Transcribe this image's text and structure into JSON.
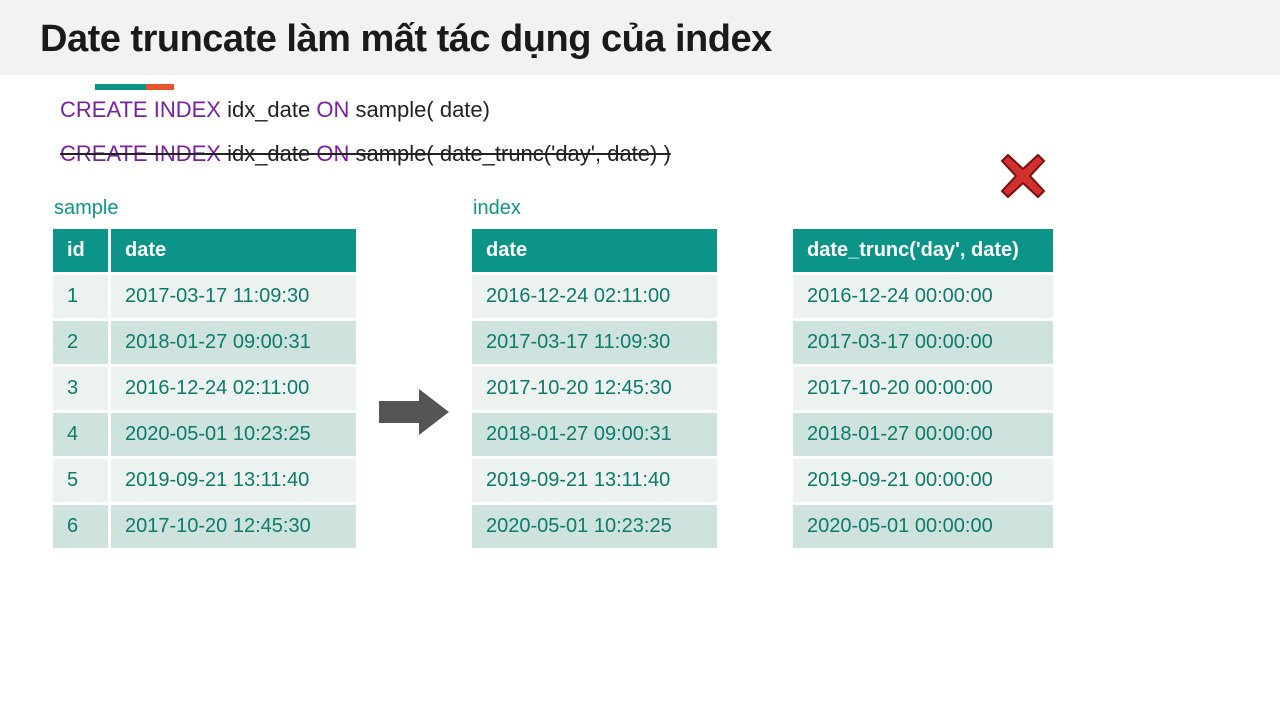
{
  "title": "Date truncate làm mất tác dụng của index",
  "sql1": {
    "create": "CREATE INDEX",
    "name": " idx_date ",
    "on": "ON",
    "rest": " sample( date)"
  },
  "sql2": {
    "create": "CREATE INDEX",
    "name": " idx_date ",
    "on": "ON",
    "rest": " sample( date_trunc('day', date) )"
  },
  "sampleLabel": "sample",
  "indexLabel": "index",
  "sample": {
    "headers": {
      "id": "id",
      "date": "date"
    },
    "rows": [
      {
        "id": "1",
        "date": "2017-03-17 11:09:30"
      },
      {
        "id": "2",
        "date": "2018-01-27 09:00:31"
      },
      {
        "id": "3",
        "date": "2016-12-24 02:11:00"
      },
      {
        "id": "4",
        "date": "2020-05-01 10:23:25"
      },
      {
        "id": "5",
        "date": "2019-09-21 13:11:40"
      },
      {
        "id": "6",
        "date": "2017-10-20 12:45:30"
      }
    ]
  },
  "index": {
    "header": "date",
    "rows": [
      "2016-12-24 02:11:00",
      "2017-03-17 11:09:30",
      "2017-10-20 12:45:30",
      "2018-01-27 09:00:31",
      "2019-09-21 13:11:40",
      "2020-05-01 10:23:25"
    ]
  },
  "trunc": {
    "header": "date_trunc('day', date)",
    "rows": [
      "2016-12-24 00:00:00",
      "2017-03-17 00:00:00",
      "2017-10-20 00:00:00",
      "2018-01-27 00:00:00",
      "2019-09-21 00:00:00",
      "2020-05-01 00:00:00"
    ]
  }
}
